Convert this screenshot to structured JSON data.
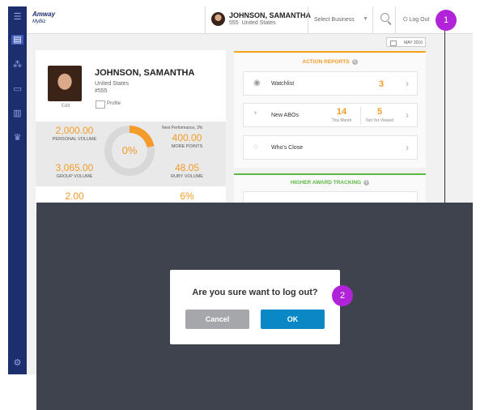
{
  "header": {
    "logo_brand": "Amway",
    "logo_sub": "MyBiz",
    "user_name": "JOHNSON, SAMANTHA",
    "user_number": "555",
    "user_country": "United States",
    "business_select_placeholder": "Select Business",
    "logout_label": "Log Out"
  },
  "callouts": {
    "first": "1",
    "second": "2"
  },
  "date_button": "MAY 2016",
  "profile": {
    "name": "JOHNSON, SAMANTHA",
    "country": "United States",
    "number": "#555",
    "edit_label": "Edit",
    "profile_label": "Profile"
  },
  "stats": {
    "personal_volume_value": "2,000.00",
    "personal_volume_label": "PERSONAL VOLUME",
    "next_performance": "Next Performance, 3%",
    "more_points_value": "400.00",
    "more_points_label": "MORE POINTS",
    "progress_percent": "0%",
    "progress_fraction": 0.22,
    "group_volume_value": "3,065.00",
    "group_volume_label": "GROUP VOLUME",
    "ruby_volume_value": "48.05",
    "ruby_volume_label": "RUBY VOLUME",
    "extra_left_value": "2.00",
    "extra_right_value": "6%"
  },
  "action_reports": {
    "title": "ACTION REPORTS",
    "watchlist_label": "Watchlist",
    "watchlist_count": "3",
    "new_abos_label": "New ABOs",
    "new_abos_this_month": "14",
    "new_abos_this_month_label": "This Month",
    "new_abos_not_viewed": "5",
    "new_abos_not_viewed_label": "Not Yet Viewed",
    "whos_close_label": "Who's Close"
  },
  "higher_award": {
    "title": "HIGHER AWARD TRACKING"
  },
  "dialog": {
    "message": "Are you sure want to log out?",
    "cancel_label": "Cancel",
    "ok_label": "OK"
  },
  "colors": {
    "sidebar": "#1c2e6e",
    "accent_orange": "#f39c2b",
    "accent_green": "#5bb843",
    "callout": "#b023d9",
    "ok_button": "#0a87c5",
    "cancel_button": "#a5a7ab",
    "overlay": "#3f434e"
  }
}
